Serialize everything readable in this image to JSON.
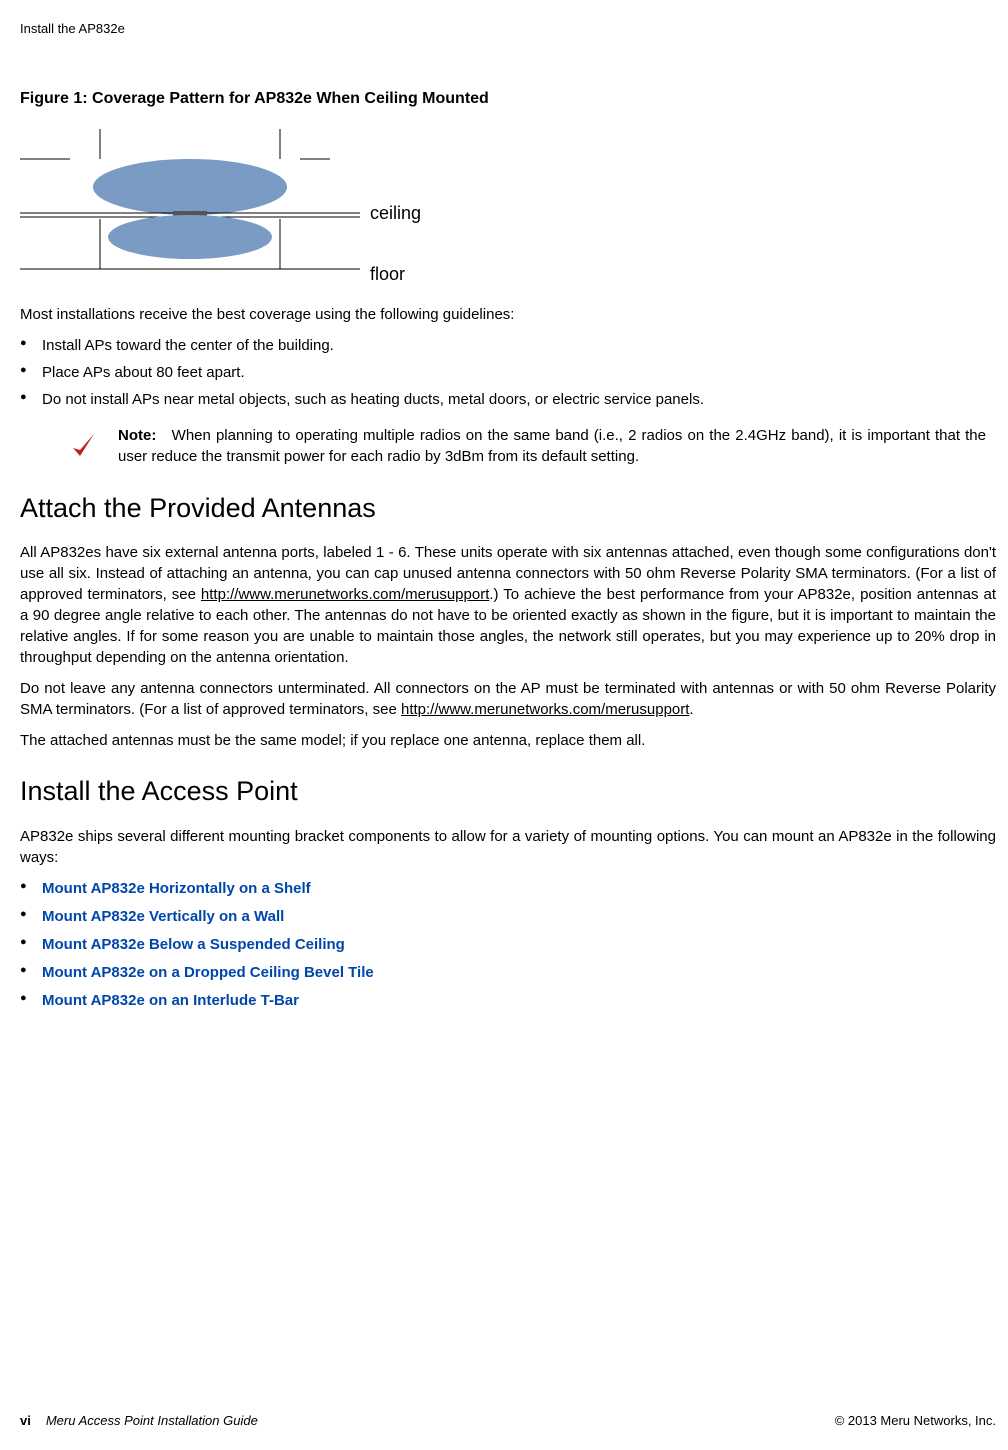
{
  "header": "Install the AP832e",
  "figure_title": "Figure 1: Coverage Pattern for AP832e When Ceiling Mounted",
  "labels": {
    "ceiling": "ceiling",
    "floor": "floor"
  },
  "p1": "Most installations receive the best coverage using the following guidelines:",
  "bullets1": [
    "Install APs toward the center of the building.",
    "Place APs about 80 feet apart.",
    "Do not install APs near metal objects, such as heating ducts, metal doors, or electric service panels."
  ],
  "note": {
    "label": "Note:",
    "text": "When planning to operating multiple radios on the same band (i.e., 2 radios on the 2.4GHz band), it is important that the user reduce the transmit power for each radio by 3dBm from its default setting."
  },
  "h2a": "Attach the Provided Antennas",
  "p2_pre": "All AP832es have six external antenna ports, labeled 1 - 6. These units operate with six antennas attached, even though some configurations don't use all six. Instead of attaching an antenna, you can cap unused antenna connectors with 50 ohm Reverse Polarity SMA terminators. (For a list of approved terminators, see ",
  "p2_link": "http://www.merunetworks.com/merusupport",
  "p2_post": ".) To achieve the best performance from your AP832e, position antennas at a 90 degree angle relative to each other. The antennas do not have to be oriented exactly as shown in the figure, but it is important to maintain the relative angles. If for some reason you are unable to maintain those angles, the network still operates, but you may experience up to 20% drop in throughput depending on the antenna orientation.",
  "p3_pre": "Do not leave any antenna connectors unterminated. All connectors on the AP must be terminated with antennas or with 50 ohm Reverse Polarity SMA terminators. (For a list of approved terminators, see ",
  "p3_link": "http://www.merunetworks.com/merusupport",
  "p3_post": ".",
  "p4": "The attached antennas must be the same model; if you replace one antenna, replace them all.",
  "h2b": "Install the Access Point",
  "p5": "AP832e ships several different mounting bracket components to allow for a variety of mounting options. You can mount an AP832e in the following ways:",
  "links": [
    "Mount AP832e Horizontally on a Shelf",
    "Mount AP832e Vertically on a Wall",
    "Mount AP832e Below a Suspended Ceiling",
    "Mount AP832e on a Dropped Ceiling Bevel Tile",
    "Mount AP832e on an Interlude T-Bar"
  ],
  "footer": {
    "pagenum": "vi",
    "guide": "Meru Access Point Installation Guide",
    "copyright": "© 2013 Meru Networks, Inc."
  }
}
